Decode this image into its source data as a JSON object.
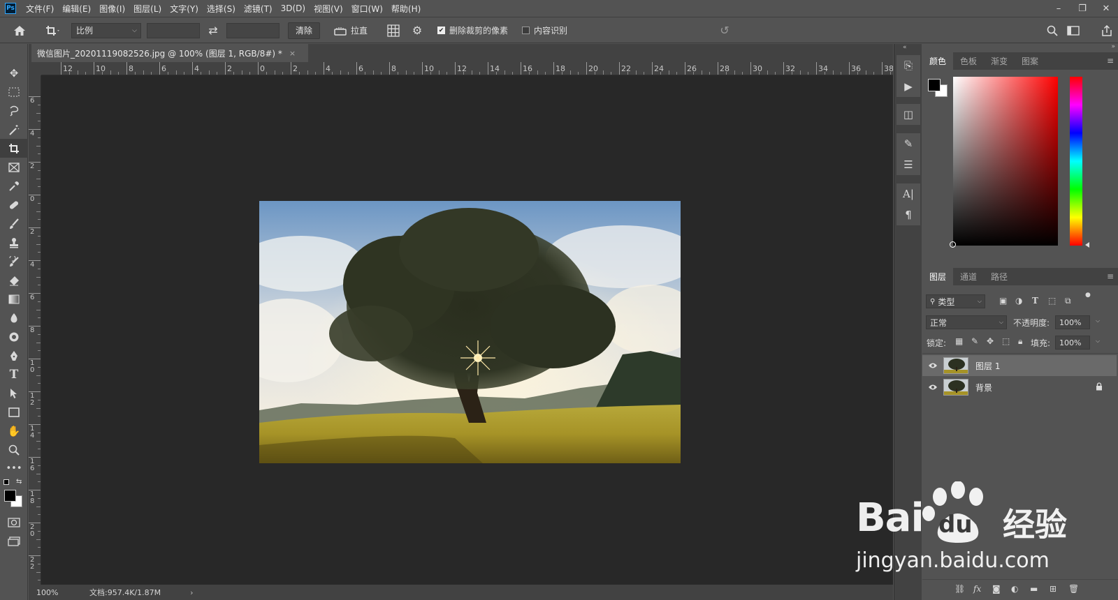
{
  "menubar": {
    "logo": "Ps",
    "items": [
      "文件(F)",
      "编辑(E)",
      "图像(I)",
      "图层(L)",
      "文字(Y)",
      "选择(S)",
      "滤镜(T)",
      "3D(D)",
      "视图(V)",
      "窗口(W)",
      "帮助(H)"
    ],
    "window_controls": {
      "minimize": "–",
      "restore": "❐",
      "close": "✕"
    }
  },
  "options": {
    "ratio_select": "比例",
    "clear_button": "清除",
    "straighten_label": "拉直",
    "delete_cropped_label": "删除裁剪的像素",
    "delete_cropped_checked": true,
    "content_aware_label": "内容识别",
    "content_aware_checked": false
  },
  "document": {
    "tab_title": "微信图片_20201119082526.jpg @ 100% (图层 1, RGB/8#) *",
    "tab_close": "×",
    "ruler_h_labels": [
      "12",
      "10",
      "8",
      "6",
      "4",
      "2",
      "0",
      "2",
      "4",
      "6",
      "8",
      "10",
      "12",
      "14",
      "16",
      "18",
      "20",
      "22",
      "24",
      "26",
      "28",
      "30",
      "32",
      "34",
      "36",
      "38"
    ],
    "ruler_v_labels": [
      "6",
      "4",
      "2",
      "0",
      "2",
      "4",
      "6",
      "8",
      "1 0",
      "1 2",
      "1 4",
      "1 6",
      "1 8",
      "2 0",
      "2 2"
    ],
    "zoom": "100%",
    "doc_info": "文档:957.4K/1.87M",
    "status_arrow": "›"
  },
  "color_panel": {
    "tabs": [
      "颜色",
      "色板",
      "渐变",
      "图案"
    ],
    "active_tab": 0,
    "foreground": "#000000",
    "background": "#ffffff",
    "hue": "#ff0000"
  },
  "layers_panel": {
    "tabs": [
      "图层",
      "通道",
      "路径"
    ],
    "active_tab": 0,
    "filter_label": "类型",
    "blend_mode": "正常",
    "opacity_label": "不透明度:",
    "opacity_value": "100%",
    "lock_label": "锁定:",
    "fill_label": "填充:",
    "fill_value": "100%",
    "layers": [
      {
        "name": "图层 1",
        "selected": true,
        "locked": false
      },
      {
        "name": "背景",
        "selected": false,
        "locked": true
      }
    ],
    "bottom_icons": [
      "link-icon",
      "fx-icon",
      "mask-icon",
      "adjustment-icon",
      "folder-icon",
      "new-layer-icon",
      "trash-icon"
    ]
  },
  "watermark": {
    "brand": "Bai",
    "brand2": "du",
    "cn": "经验",
    "url": "jingyan.baidu.com"
  }
}
